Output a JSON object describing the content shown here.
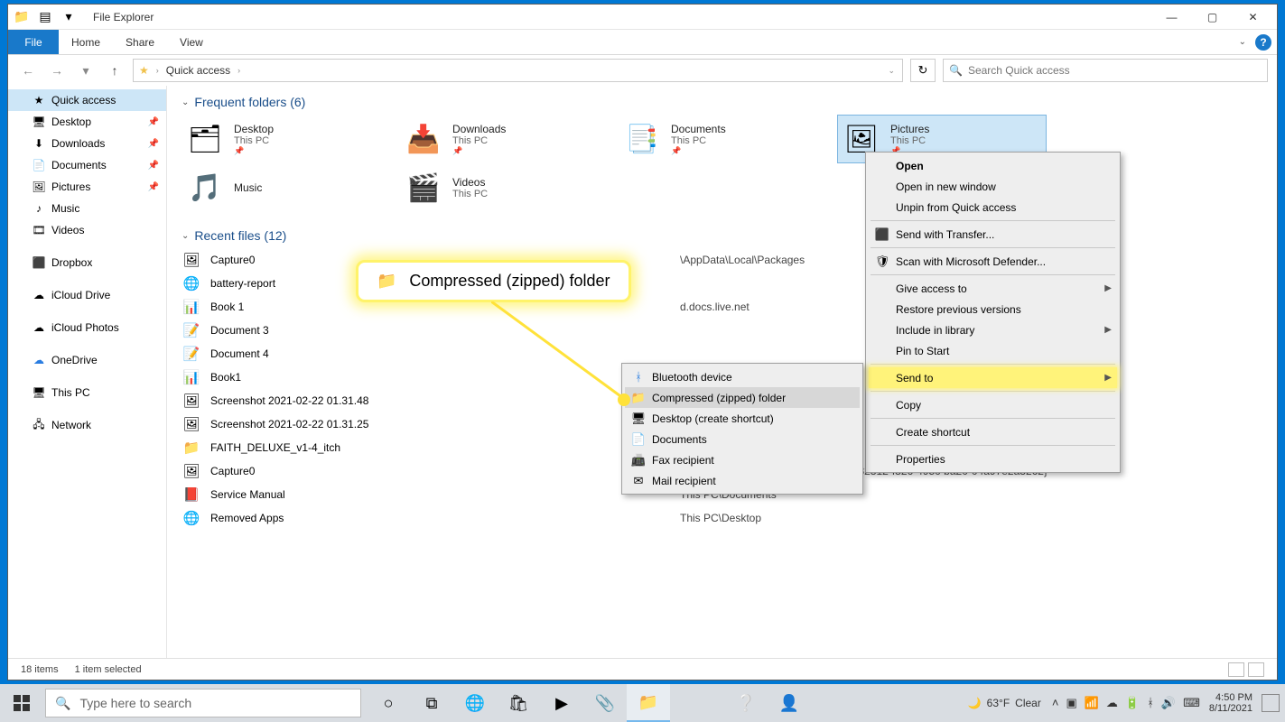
{
  "window": {
    "title": "File Explorer",
    "controls": {
      "min": "—",
      "max": "▢",
      "close": "✕"
    }
  },
  "ribbon": {
    "file": "File",
    "tabs": [
      "Home",
      "Share",
      "View"
    ]
  },
  "address": {
    "crumb1": "Quick access",
    "refresh": "↻"
  },
  "search": {
    "placeholder": "Search Quick access"
  },
  "sidebar": {
    "items": [
      {
        "icon": "★",
        "label": "Quick access",
        "pinned": false,
        "selected": true
      },
      {
        "icon": "🖥",
        "label": "Desktop",
        "pinned": true
      },
      {
        "icon": "⬇",
        "label": "Downloads",
        "pinned": true
      },
      {
        "icon": "📄",
        "label": "Documents",
        "pinned": true
      },
      {
        "icon": "🖼",
        "label": "Pictures",
        "pinned": true
      },
      {
        "icon": "♪",
        "label": "Music"
      },
      {
        "icon": "🎞",
        "label": "Videos"
      }
    ],
    "cloud": [
      {
        "icon": "⬛",
        "label": "Dropbox"
      },
      {
        "icon": "☁",
        "label": "iCloud Drive"
      },
      {
        "icon": "☁",
        "label": "iCloud Photos"
      },
      {
        "icon": "☁",
        "label": "OneDrive"
      }
    ],
    "system": [
      {
        "icon": "🖥",
        "label": "This PC"
      },
      {
        "icon": "🖧",
        "label": "Network"
      }
    ]
  },
  "content": {
    "frequent_header": "Frequent folders (6)",
    "frequent": [
      {
        "name": "Desktop",
        "sub": "This PC",
        "pinned": true
      },
      {
        "name": "Downloads",
        "sub": "This PC",
        "pinned": true
      },
      {
        "name": "Documents",
        "sub": "This PC",
        "pinned": true
      },
      {
        "name": "Pictures",
        "sub": "This PC",
        "pinned": true,
        "selected": true
      },
      {
        "name": "Music",
        "sub": "",
        "pinned": false
      },
      {
        "name": "Videos",
        "sub": "This PC",
        "pinned": false
      }
    ],
    "recent_header": "Recent files (12)",
    "recent": [
      {
        "icon": "🖼",
        "name": "Capture0",
        "path": "\\AppData\\Local\\Packages"
      },
      {
        "icon": "🌐",
        "name": "battery-report",
        "path": ""
      },
      {
        "icon": "📊",
        "name": "Book 1",
        "path": "d.docs.live.net"
      },
      {
        "icon": "📝",
        "name": "Document 3",
        "path": ""
      },
      {
        "icon": "📝",
        "name": "Document 4",
        "path": ""
      },
      {
        "icon": "📊",
        "name": "Book1",
        "path": ""
      },
      {
        "icon": "🖼",
        "name": "Screenshot 2021-02-22 01.31.48",
        "path": ""
      },
      {
        "icon": "🖼",
        "name": "Screenshot 2021-02-22 01.31.25",
        "path": ""
      },
      {
        "icon": "📁",
        "name": "FAITH_DELUXE_v1-4_itch",
        "path": ""
      },
      {
        "icon": "🖼",
        "name": "Capture0",
        "path": "\\AppData\\Local\\Packages\\Mic...\\{66182812-f826-495c-ba20-04a97e2a3262}"
      },
      {
        "icon": "📕",
        "name": "Service Manual",
        "path": "This PC\\Documents"
      },
      {
        "icon": "🌐",
        "name": "Removed Apps",
        "path": "This PC\\Desktop"
      }
    ]
  },
  "statusbar": {
    "count": "18 items",
    "selected": "1 item selected"
  },
  "context_main": {
    "items": [
      {
        "label": "Open",
        "bold": true
      },
      {
        "label": "Open in new window"
      },
      {
        "label": "Unpin from Quick access"
      },
      {
        "sep": true
      },
      {
        "icon": "⬛",
        "label": "Send with Transfer..."
      },
      {
        "sep": true
      },
      {
        "icon": "🛡",
        "label": "Scan with Microsoft Defender..."
      },
      {
        "sep": true
      },
      {
        "label": "Give access to",
        "submenu": true
      },
      {
        "label": "Restore previous versions"
      },
      {
        "label": "Include in library",
        "submenu": true
      },
      {
        "label": "Pin to Start"
      },
      {
        "sep": true
      },
      {
        "label": "Send to",
        "submenu": true,
        "highlight": true
      },
      {
        "sep": true
      },
      {
        "label": "Copy"
      },
      {
        "sep": true
      },
      {
        "label": "Create shortcut"
      },
      {
        "sep": true
      },
      {
        "label": "Properties"
      }
    ]
  },
  "context_sub": {
    "items": [
      {
        "icon": "ᚼ",
        "iconColor": "#2a7de1",
        "label": "Bluetooth device"
      },
      {
        "icon": "📁",
        "label": "Compressed (zipped) folder",
        "hover": true
      },
      {
        "icon": "🖥",
        "label": "Desktop (create shortcut)"
      },
      {
        "icon": "📄",
        "label": "Documents"
      },
      {
        "icon": "📠",
        "label": "Fax recipient"
      },
      {
        "icon": "✉",
        "label": "Mail recipient"
      }
    ]
  },
  "callout": {
    "text": "Compressed (zipped) folder"
  },
  "taskbar": {
    "search": "Type here to search",
    "weather_temp": "63°F",
    "weather_cond": "Clear",
    "time": "4:50 PM",
    "date": "8/11/2021"
  }
}
